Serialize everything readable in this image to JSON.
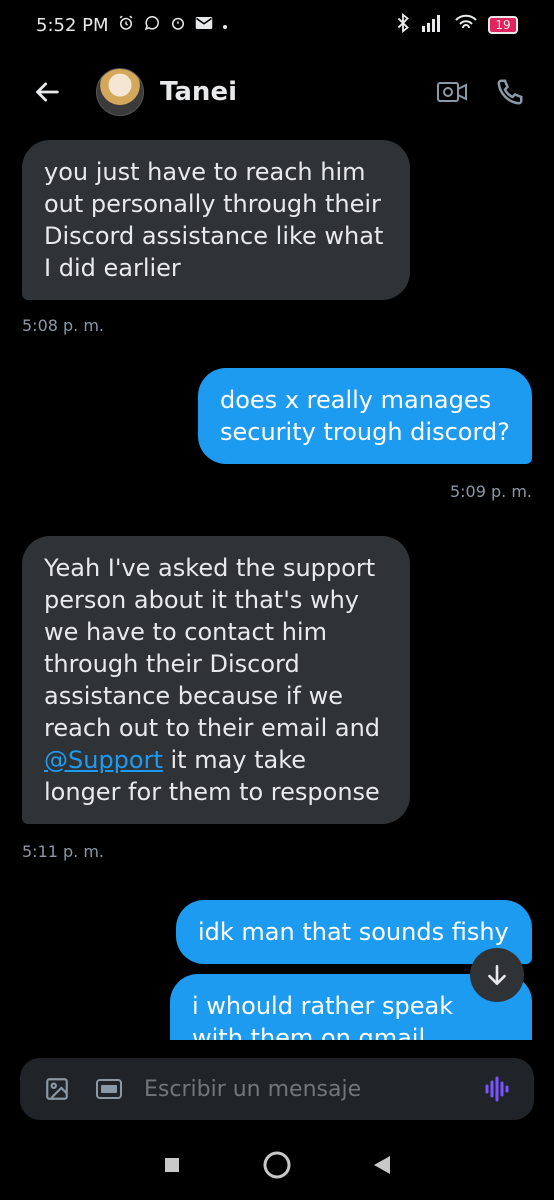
{
  "status": {
    "time": "5:52 PM",
    "battery": "19"
  },
  "header": {
    "contact_name": "Tanei"
  },
  "messages": [
    {
      "text": "you just have to reach him out personally through their Discord assistance like what I did earlier",
      "time": "5:08 p. m."
    },
    {
      "text": "does x really manages security trough discord?",
      "time": "5:09 p. m."
    },
    {
      "text_before": "Yeah I've asked the support person about it that's why we have to contact him through their Discord assistance because if we reach out to their email and",
      "mention": "@Support",
      "text_after": "it may take longer for them to response",
      "time": "5:11 p. m."
    },
    {
      "text": "idk man that sounds fishy"
    },
    {
      "text": "i whould rather speak with them on gmail"
    }
  ],
  "composer": {
    "placeholder": "Escribir un mensaje"
  },
  "colors": {
    "accent": "#1d9bf0",
    "incoming_bubble": "#2f3336",
    "background": "#000000"
  }
}
